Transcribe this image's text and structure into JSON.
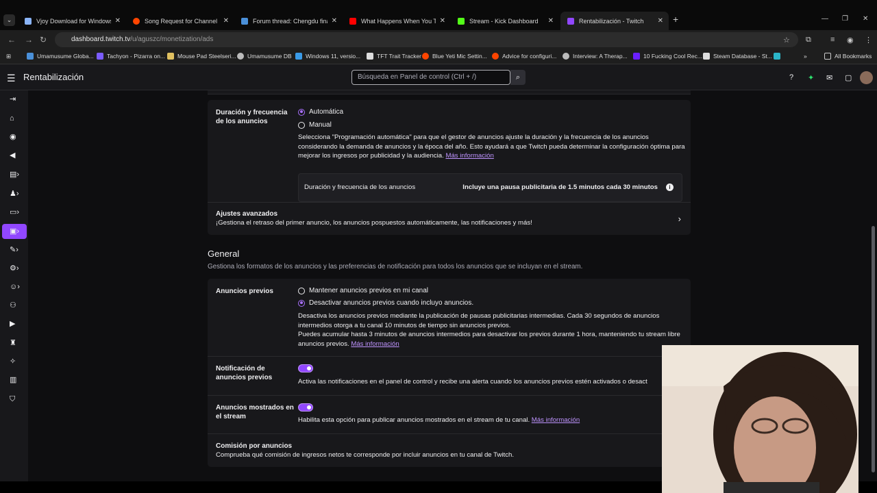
{
  "browser": {
    "tabs": [
      {
        "title": "Vjoy Download for Windows Fr",
        "color": "#8ab4f8"
      },
      {
        "title": "Song Request for Channel Poin",
        "color": "#ff4500"
      },
      {
        "title": "Forum thread: Chengdu final | I",
        "color": "#4a90d9"
      },
      {
        "title": "What Happens When You Turn",
        "color": "#ff0000"
      },
      {
        "title": "Stream - Kick Dashboard",
        "color": "#53fc18"
      },
      {
        "title": "Rentabilización - Twitch",
        "color": "#9147ff"
      }
    ],
    "url_host": "dashboard.twitch.tv",
    "url_path": "/u/aguszc/monetization/ads",
    "bookmarks": [
      {
        "label": "Umamusume Globa...",
        "color": "#4a90d9"
      },
      {
        "label": "Tachyon - Pizarra on...",
        "color": "#7b5cff"
      },
      {
        "label": "Mouse Pad Steelseri...",
        "color": "#e0c060"
      },
      {
        "label": "Umamusume DB",
        "color": "#bbbbbb"
      },
      {
        "label": "Windows 11, versio...",
        "color": "#3a9be8"
      },
      {
        "label": "TFT Trait Tracker",
        "color": "#dddddd"
      },
      {
        "label": "Blue Yeti Mic Settin...",
        "color": "#ff4500"
      },
      {
        "label": "Advice for configuri...",
        "color": "#ff4500"
      },
      {
        "label": "Interview: A Therap...",
        "color": "#bbbbbb"
      },
      {
        "label": "10 Fucking Cool Rec...",
        "color": "#6a1fff"
      },
      {
        "label": "Steam Database - St...",
        "color": "#dddddd"
      }
    ],
    "all_bookmarks": "All Bookmarks"
  },
  "topnav": {
    "title": "Rentabilización",
    "search_placeholder": "Búsqueda en Panel de control (Ctrl + /)"
  },
  "ads": {
    "duration_label": "Duración y frecuencia de los anuncios",
    "option_auto": "Automática",
    "option_manual": "Manual",
    "auto_desc": "Selecciona \"Programación automática\" para que el gestor de anuncios ajuste la duración y la frecuencia de los anuncios considerando la demanda de anuncios y la época del año. Esto ayudará a que Twitch pueda determinar la configuración óptima para mejorar los ingresos por publicidad y la audiencia.",
    "more_info": "Más información",
    "info_label": "Duración y frecuencia de los anuncios",
    "info_value": "Incluye una pausa publicitaria de 1.5 minutos cada 30 minutos",
    "advanced_title": "Ajustes avanzados",
    "advanced_desc": "¡Gestiona el retraso del primer anuncio, los anuncios pospuestos automáticamente, las notificaciones y más!"
  },
  "general": {
    "heading": "General",
    "subheading": "Gestiona los formatos de los anuncios y las preferencias de notificación para todos los anuncios que se incluyan en el stream.",
    "preroll_label": "Anuncios previos",
    "preroll_opt1": "Mantener anuncios previos en mi canal",
    "preroll_opt2": "Desactivar anuncios previos cuando incluyo anuncios.",
    "preroll_desc1": "Desactiva los anuncios previos mediante la publicación de pausas publicitarias intermedias. Cada 30 segundos de anuncios intermedios otorga a tu canal 10 minutos de tiempo sin anuncios previos.",
    "preroll_desc2": "Puedes acumular hasta 3 minutos de anuncios intermedios para desactivar los previos durante 1 hora, manteniendo tu stream libre anuncios previos.",
    "more_info": "Más información",
    "notif_label": "Notificación de anuncios previos",
    "notif_desc": "Activa las notificaciones en el panel de control y recibe una alerta cuando los anuncios previos estén activados o desact",
    "shown_label": "Anuncios mostrados en el stream",
    "shown_desc": "Habilita esta opción para publicar anuncios mostrados en el stream de tu canal.",
    "commission_title": "Comisión por anuncios",
    "commission_desc": "Comprueba qué comisión de ingresos netos te corresponde por incluir anuncios en tu canal de Twitch."
  }
}
